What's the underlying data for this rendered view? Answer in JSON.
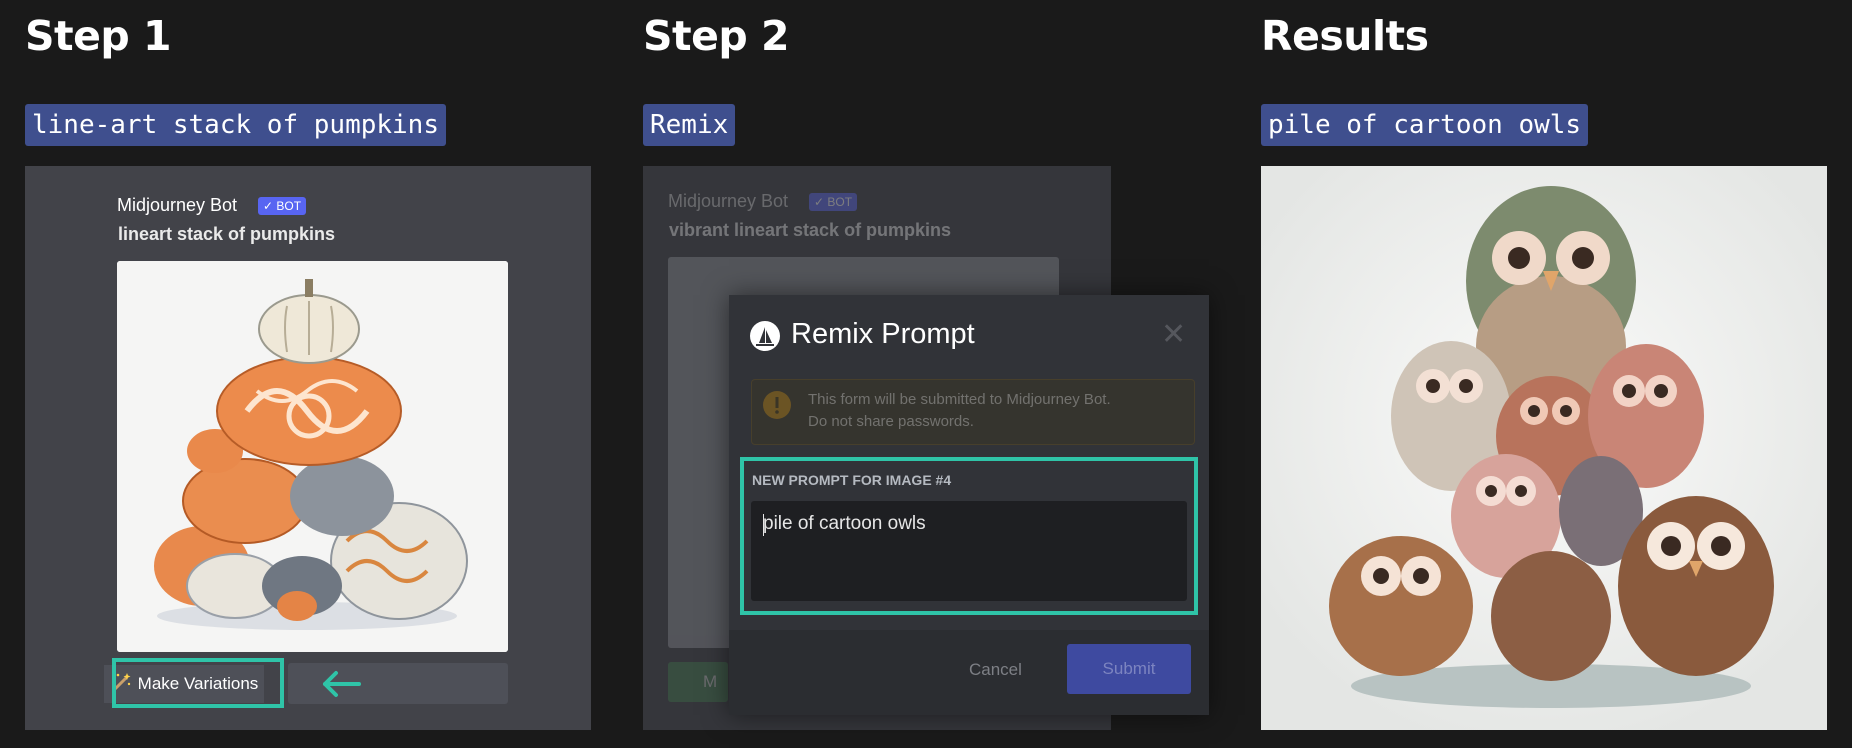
{
  "steps": [
    {
      "title": "Step 1",
      "tag": "line-art stack of pumpkins"
    },
    {
      "title": "Step 2",
      "tag": "Remix"
    },
    {
      "title": "Results",
      "tag": "pile of cartoon owls"
    }
  ],
  "step1": {
    "bot_name": "Midjourney Bot",
    "bot_badge": "✓ BOT",
    "prompt": "lineart stack of pumpkins",
    "variations_label": "Make Variations",
    "variations_icon": "magic-wand-icon"
  },
  "step2": {
    "bot_name": "Midjourney Bot",
    "bot_badge": "✓ BOT",
    "prompt": "vibrant lineart stack of pumpkins",
    "modal": {
      "title": "Remix Prompt",
      "close": "✕",
      "warning_line1": "This form will be submitted to Midjourney Bot.",
      "warning_line2": "Do not share passwords.",
      "field_label": "NEW PROMPT FOR IMAGE #4",
      "field_value": "pile of cartoon owls",
      "cancel_label": "Cancel",
      "submit_label": "Submit",
      "behind_button": "M"
    }
  },
  "colors": {
    "accent": "#2fc4a8",
    "tag_bg": "#3f4f8e",
    "discord_blurple": "#5865f2"
  }
}
